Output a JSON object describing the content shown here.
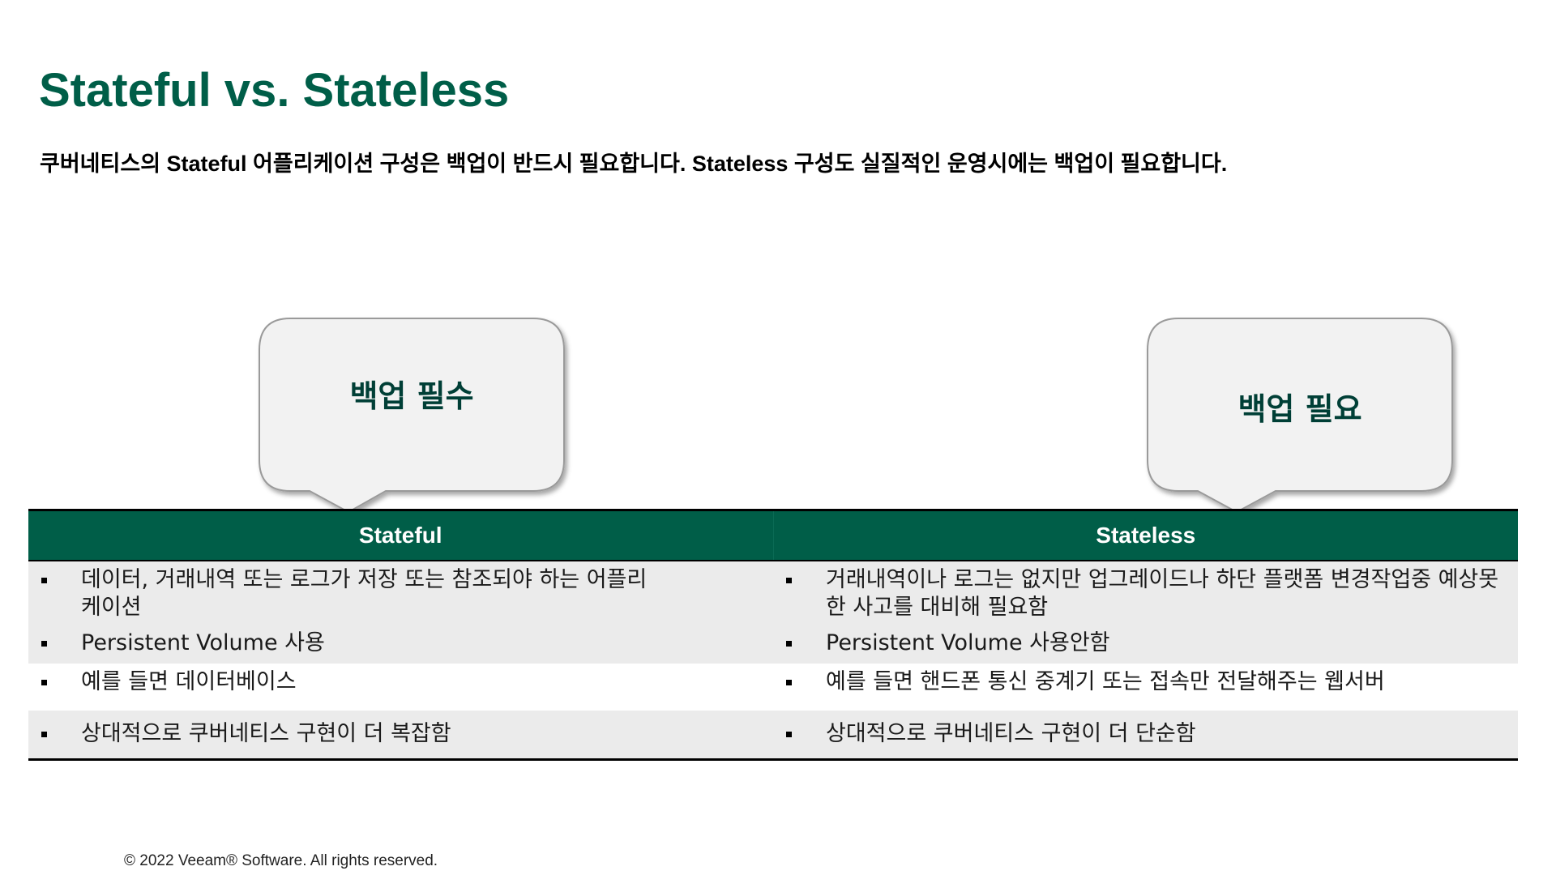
{
  "slide": {
    "title": "Stateful vs. Stateless",
    "subtitle": "쿠버네티스의 Stateful 어플리케이션 구성은 백업이 반드시 필요합니다. Stateless 구성도 실질적인 운영시에는 백업이 필요합니다."
  },
  "callouts": {
    "left": {
      "label": "백업 필수"
    },
    "right": {
      "label": "백업 필요"
    }
  },
  "table": {
    "headers": [
      "Stateful",
      "Stateless"
    ],
    "rows": [
      [
        "데이터, 거래내역 또는 로그가 저장 또는 참조되야 하는 어플리케이션",
        "거래내역이나 로그는 없지만 업그레이드나 하단 플랫폼 변경작업중 예상못한 사고를 대비해 필요함"
      ],
      [
        "Persistent Volume 사용",
        "Persistent Volume 사용안함"
      ],
      [
        "예를 들면 데이터베이스",
        "예를 들면 핸드폰 통신 중계기 또는 접속만 전달해주는 웹서버"
      ],
      [
        "상대적으로 쿠버네티스 구현이 더 복잡함",
        "상대적으로 쿠버네티스 구현이 더 단순함"
      ]
    ]
  },
  "footer": {
    "copyright": "© 2022 Veeam® Software. All rights reserved."
  },
  "colors": {
    "brand_green": "#005e48",
    "row_shade": "#ebebeb",
    "callout_fill": "#f2f2f2"
  }
}
